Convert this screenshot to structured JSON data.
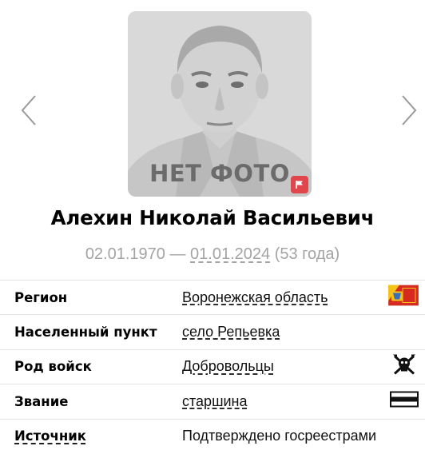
{
  "photo": {
    "placeholder_text": "НЕТ ФОТО",
    "report_icon": "flag-icon",
    "report_color": "#e0464b"
  },
  "navigation": {
    "prev_icon": "chevron-left-icon",
    "next_icon": "chevron-right-icon"
  },
  "person": {
    "name": "Алехин Николай Васильевич",
    "birth_date": "02.01.1970",
    "separator": " — ",
    "death_date": "01.01.2024",
    "age": "(53 года)"
  },
  "details": {
    "region": {
      "label": "Регион",
      "value": "Воронежская область",
      "icon": "region-flag-icon"
    },
    "locality": {
      "label": "Населенный пункт",
      "value": "село Репьевка"
    },
    "branch": {
      "label": "Род войск",
      "value": "Добровольцы",
      "icon": "volunteer-emblem-icon"
    },
    "rank": {
      "label": "Звание",
      "value": "старшина",
      "icon": "rank-insignia-icon"
    },
    "source": {
      "label": "Источник",
      "value": "Подтверждено госреестрами"
    }
  },
  "colors": {
    "muted_text": "#a3a3a3",
    "divider": "#e4e4e4",
    "flag_red": "#e0464b",
    "region_flag_red": "#d72b20",
    "region_flag_yellow": "#f4c21a"
  }
}
